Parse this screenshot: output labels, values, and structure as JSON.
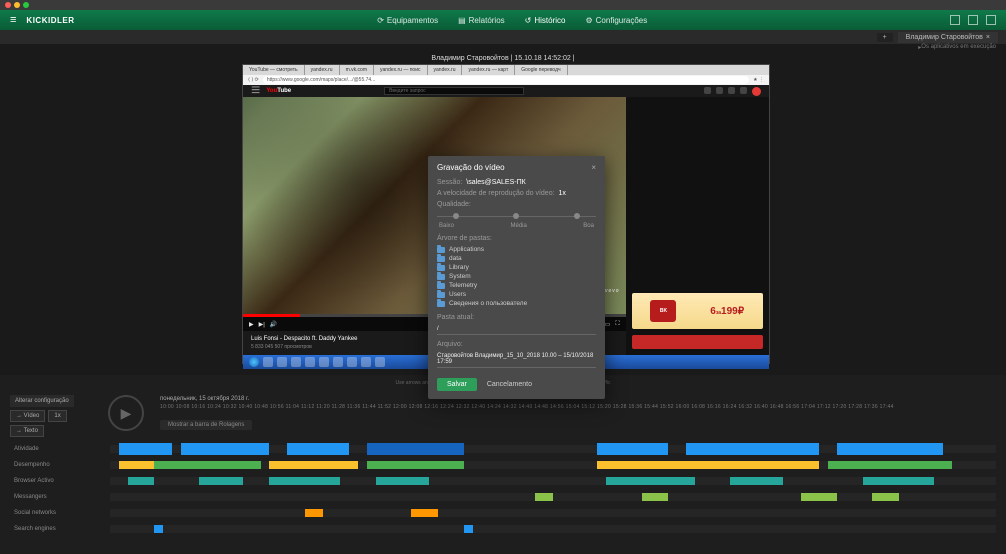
{
  "topnav": {
    "logo": "KICKIDLER",
    "items": [
      "Equipamentos",
      "Relatórios",
      "Histórico",
      "Configurações"
    ],
    "active_index": 2
  },
  "session": {
    "user": "Владимир Старовойтов",
    "plus": "+",
    "exec_text": "Os aplicativos em execução"
  },
  "title_center": "Владимир Старовойтов    |  15.10.18 14:52:02 |",
  "browser": {
    "tabs": [
      "YouTube — смотреть",
      "yandex.ru",
      "m.vk.com",
      "yandex.ru — поис",
      "yandex.ru",
      "yandex.ru — карт",
      "Google переводч"
    ],
    "url": "https://www.google.com/maps/place/.../@55.74...",
    "yt": {
      "logo_a": "You",
      "logo_b": "Tube",
      "search_placeholder": "Введите запрос",
      "video_title": "Luis Fonsi - Despacito ft. Daddy Yankee",
      "video_views": "5 833 045 507 просмотров",
      "vevo": "vevo"
    },
    "ad": {
      "brand": "BK",
      "price_small": "6",
      "price_sep": "за",
      "price_big": "199₽"
    }
  },
  "modal": {
    "title": "Gravação do vídeo",
    "session_label": "Sessão:",
    "session_value": "\\sales@SALES-ПК",
    "speed_label": "A velocidade de reprodução do vídeo:",
    "speed_value": "1x",
    "quality_label": "Qualidade:",
    "quality_ticks": [
      "Baixo",
      "Média",
      "Boa"
    ],
    "tree_label": "Árvore de pastas:",
    "tree": [
      "Applications",
      "data",
      "Library",
      "System",
      "Telemetry",
      "Users",
      "Сведения о пользователе"
    ],
    "current_folder_label": "Pasta atual:",
    "current_folder": "/",
    "file_label": "Arquivo:",
    "file_value": "Старовойтов Владимир_15_10_2018 10.00 – 15/10/2018 17:59",
    "save": "Salvar",
    "cancel": "Cancelamento"
  },
  "timeline": {
    "note": "Use arrows and CTRL + ← / → to navigate — timeline, activities, productivity bars, network traffic",
    "config": "Alterar configuração",
    "sel1": "Vídeo",
    "sel2": "1x",
    "sel3": "Texto",
    "date": "понедельник, 15 октября 2018 г.",
    "ruler": "10:00  10:08  10:16  10:24  10:32  10:40  10:48  10:56  11:04  11:12  11:20  11:28  11:36  11:44  11:52  12:00  12:08  12:16  12:24  12:32  12:40          14:24  14:32  14:40  14:48  14:56  15:04  15:12  15:20  15:28  15:36  15:44  15:52  16:00  16:08  16:16  16:24  16:32  16:40  16:48  16:56  17:04  17:12  17:20  17:28  17:36  17:44",
    "cat_btn": "Mostrar a barra de Rolagens",
    "rows": [
      "Atividade",
      "Desempenho",
      "Browser Activo",
      "Messangers",
      "Social networks",
      "Search engines"
    ]
  }
}
